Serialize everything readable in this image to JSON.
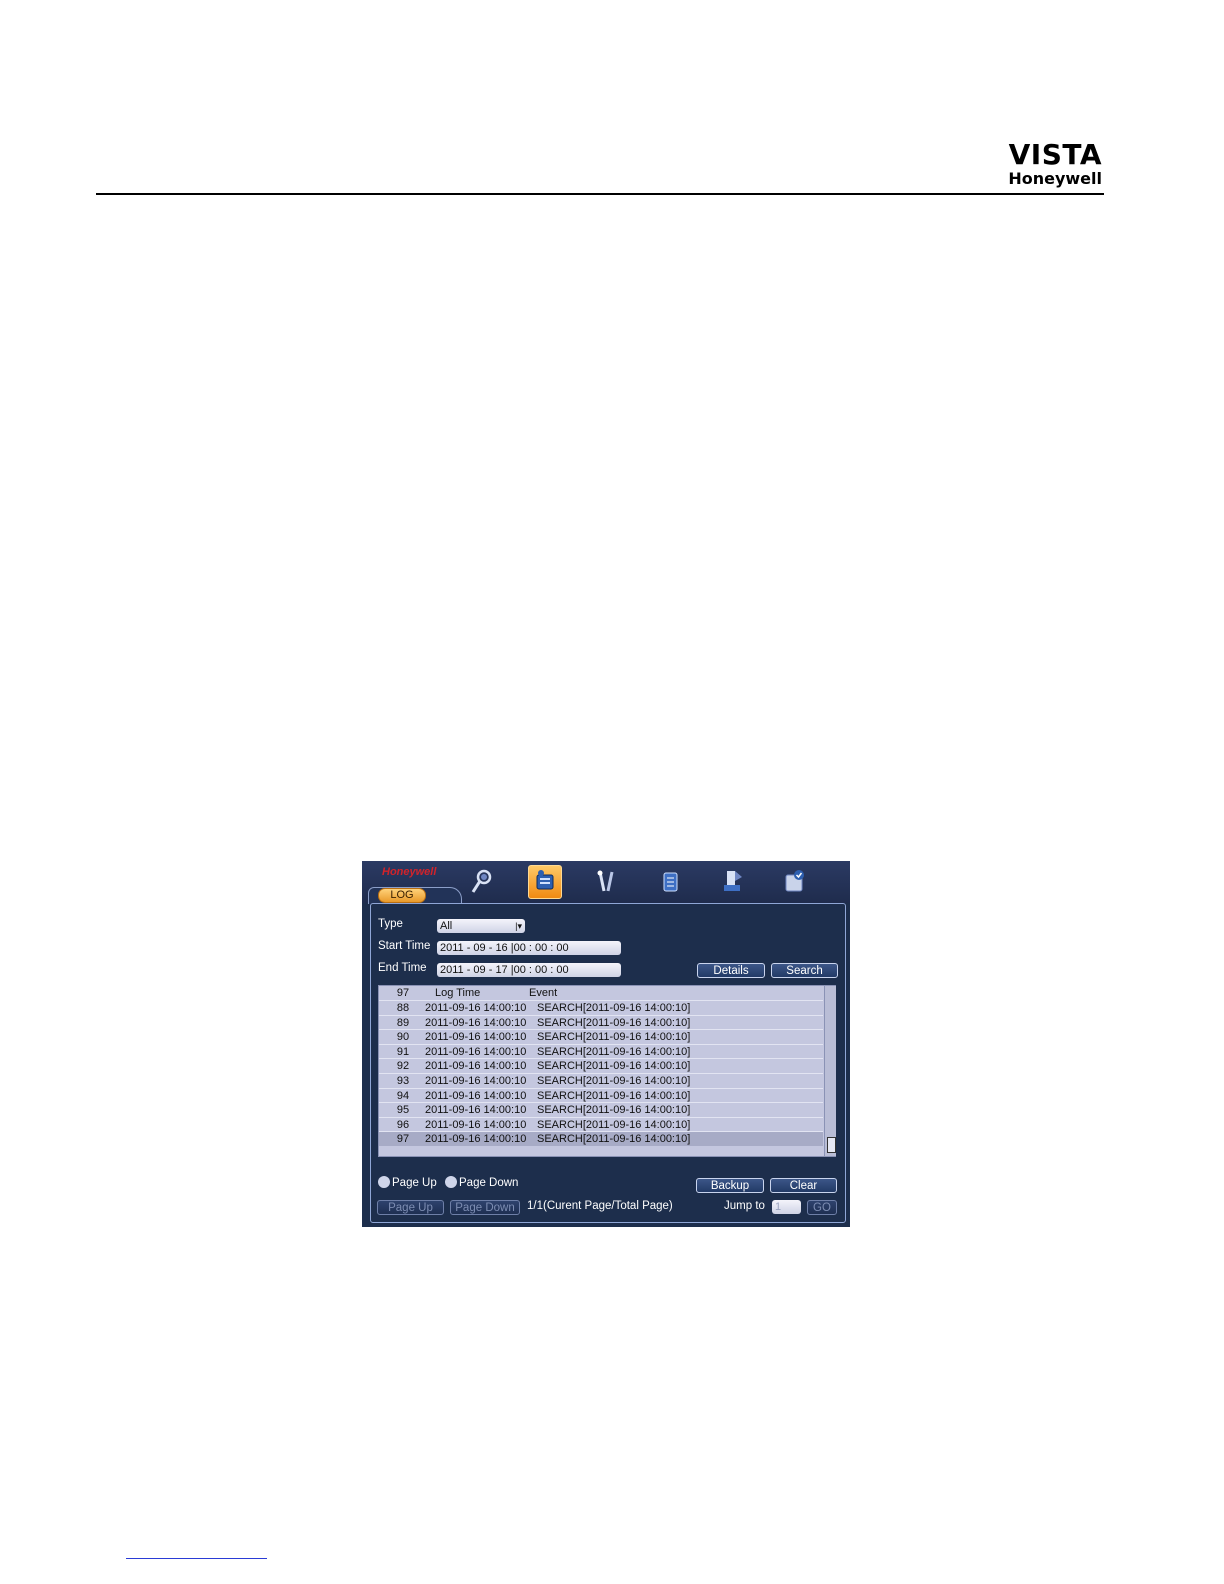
{
  "document": {
    "brand_title": "VISTA",
    "brand_subtitle": "Honeywell"
  },
  "dvr": {
    "logo": "Honeywell",
    "tab_label": "LOG",
    "nav_icons": [
      "search-icon",
      "info-icon",
      "tools-icon",
      "backup-icon",
      "maintenance-icon",
      "shutdown-icon"
    ],
    "active_nav": "info-icon",
    "form": {
      "type_label": "Type",
      "type_value": "All",
      "start_label": "Start Time",
      "start_value": "2011  - 09 - 16  |00 : 00 : 00",
      "end_label": "End Time",
      "end_value": "2011  - 09 - 17  |00 : 00 : 00",
      "details_btn": "Details",
      "search_btn": "Search"
    },
    "table": {
      "header": {
        "no": "97",
        "time": "Log Time",
        "event": "Event"
      },
      "rows": [
        {
          "no": "88",
          "time": "2011-09-16 14:00:10",
          "event": "SEARCH[2011-09-16 14:00:10]"
        },
        {
          "no": "89",
          "time": "2011-09-16 14:00:10",
          "event": "SEARCH[2011-09-16 14:00:10]"
        },
        {
          "no": "90",
          "time": "2011-09-16 14:00:10",
          "event": "SEARCH[2011-09-16 14:00:10]"
        },
        {
          "no": "91",
          "time": "2011-09-16 14:00:10",
          "event": "SEARCH[2011-09-16 14:00:10]"
        },
        {
          "no": "92",
          "time": "2011-09-16 14:00:10",
          "event": "SEARCH[2011-09-16 14:00:10]"
        },
        {
          "no": "93",
          "time": "2011-09-16 14:00:10",
          "event": "SEARCH[2011-09-16 14:00:10]"
        },
        {
          "no": "94",
          "time": "2011-09-16 14:00:10",
          "event": "SEARCH[2011-09-16 14:00:10]"
        },
        {
          "no": "95",
          "time": "2011-09-16 14:00:10",
          "event": "SEARCH[2011-09-16 14:00:10]"
        },
        {
          "no": "96",
          "time": "2011-09-16 14:00:10",
          "event": "SEARCH[2011-09-16 14:00:10]"
        },
        {
          "no": "97",
          "time": "2011-09-16 14:00:10",
          "event": "SEARCH[2011-09-16 14:00:10]"
        }
      ],
      "selected_row": "97"
    },
    "footer": {
      "hint_page_up": "Page Up",
      "hint_page_down": "Page Down",
      "backup_btn": "Backup",
      "clear_btn": "Clear",
      "page_up_btn": "Page Up",
      "page_down_btn": "Page Down",
      "page_status": "1/1(Curent Page/Total Page)",
      "jump_label": "Jump to",
      "jump_value": "1",
      "go_btn": "GO"
    }
  }
}
